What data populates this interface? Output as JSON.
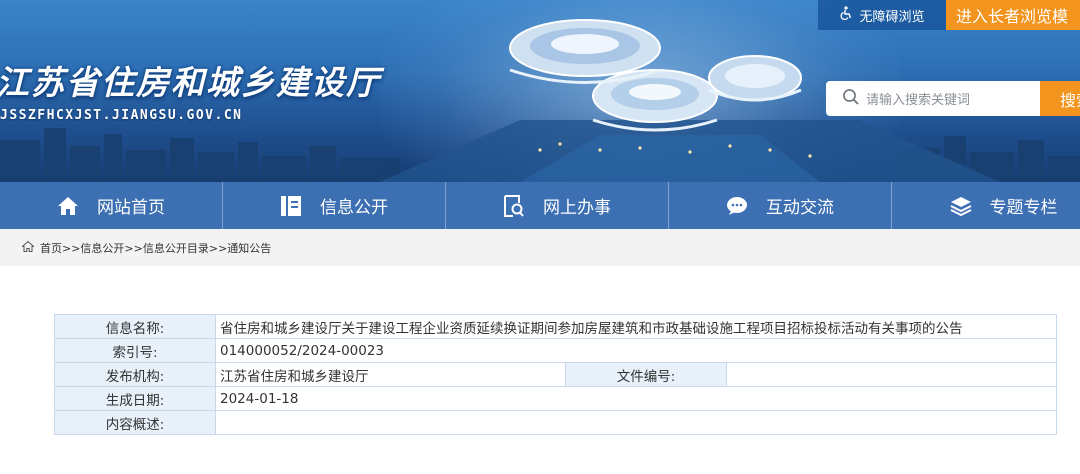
{
  "header": {
    "site_title": "江苏省住房和城乡建设厅",
    "site_domain": "JSSZFHCXJST.JIANGSU.GOV.CN",
    "accessibility_label": "无障碍浏览",
    "elder_mode_label": "进入长者浏览模",
    "search_placeholder": "请输入搜索关键词",
    "search_button_label": "搜索"
  },
  "nav": {
    "items": [
      {
        "label": "网站首页",
        "icon": "home-icon"
      },
      {
        "label": "信息公开",
        "icon": "document-icon"
      },
      {
        "label": "网上办事",
        "icon": "search-doc-icon"
      },
      {
        "label": "互动交流",
        "icon": "chat-icon"
      },
      {
        "label": "专题专栏",
        "icon": "layers-icon"
      }
    ]
  },
  "breadcrumb": {
    "text": "首页>>信息公开>>信息公开目录>>通知公告"
  },
  "info": {
    "name_label": "信息名称:",
    "name_value": "省住房和城乡建设厅关于建设工程企业资质延续换证期间参加房屋建筑和市政基础设施工程项目招标投标活动有关事项的公告",
    "index_label": "索引号:",
    "index_value": "014000052/2024-00023",
    "publisher_label": "发布机构:",
    "publisher_value": "江苏省住房和城乡建设厅",
    "docno_label": "文件编号:",
    "docno_value": "",
    "date_label": "生成日期:",
    "date_value": "2024-01-18",
    "summary_label": "内容概述:",
    "summary_value": ""
  },
  "colors": {
    "nav_bg": "#3d6fb3",
    "accent_orange": "#f2941d",
    "table_label_bg": "#e8f1fa",
    "table_border": "#c7d8ea"
  }
}
